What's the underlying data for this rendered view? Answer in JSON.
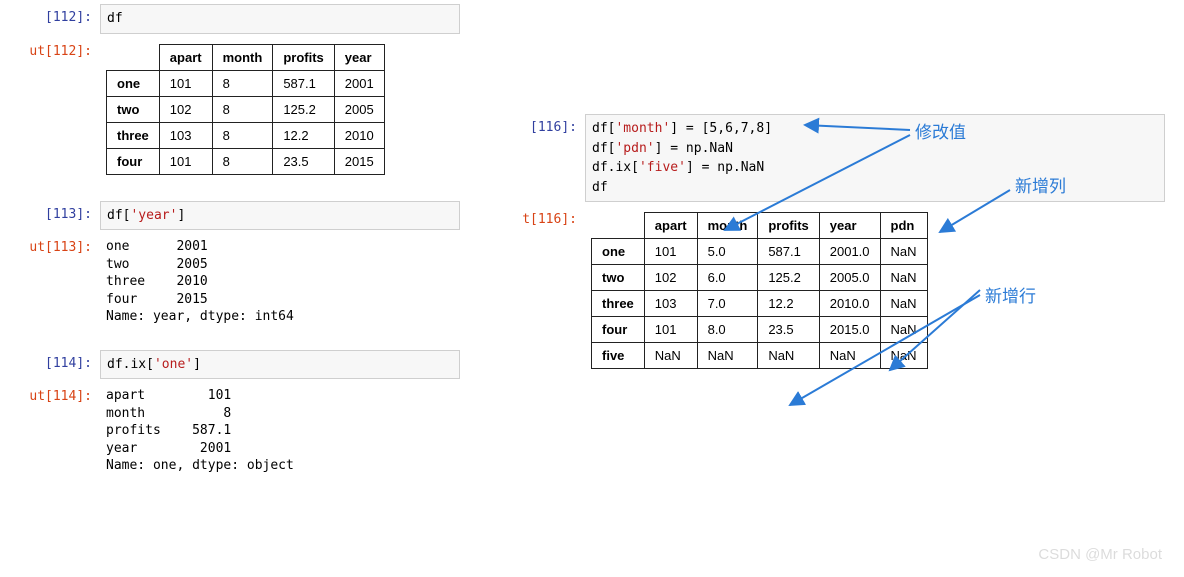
{
  "left": {
    "c112": {
      "in_prompt": "[112]:",
      "out_prompt": "ut[112]:",
      "code": "df",
      "table": {
        "headers": [
          "",
          "apart",
          "month",
          "profits",
          "year"
        ],
        "rows": [
          [
            "one",
            "101",
            "8",
            "587.1",
            "2001"
          ],
          [
            "two",
            "102",
            "8",
            "125.2",
            "2005"
          ],
          [
            "three",
            "103",
            "8",
            "12.2",
            "2010"
          ],
          [
            "four",
            "101",
            "8",
            "23.5",
            "2015"
          ]
        ]
      }
    },
    "c113": {
      "in_prompt": "[113]:",
      "out_prompt": "ut[113]:",
      "code_pre": "df[",
      "code_str": "'year'",
      "code_post": "]",
      "output": "one      2001\ntwo      2005\nthree    2010\nfour     2015\nName: year, dtype: int64"
    },
    "c114": {
      "in_prompt": "[114]:",
      "out_prompt": "ut[114]:",
      "code_pre": "df.ix[",
      "code_str": "'one'",
      "code_post": "]",
      "output": "apart        101\nmonth          8\nprofits    587.1\nyear        2001\nName: one, dtype: object"
    }
  },
  "right": {
    "c116": {
      "in_prompt": "[116]:",
      "out_prompt": "t[116]:",
      "code": {
        "l1a": "df[",
        "l1b": "'month'",
        "l1c": "] = [5,6,7,8]",
        "l2a": "df[",
        "l2b": "'pdn'",
        "l2c": "] = np.NaN",
        "l3a": "df.ix[",
        "l3b": "'five'",
        "l3c": "] = np.NaN",
        "l4": "df"
      },
      "table": {
        "headers": [
          "",
          "apart",
          "month",
          "profits",
          "year",
          "pdn"
        ],
        "rows": [
          [
            "one",
            "101",
            "5.0",
            "587.1",
            "2001.0",
            "NaN"
          ],
          [
            "two",
            "102",
            "6.0",
            "125.2",
            "2005.0",
            "NaN"
          ],
          [
            "three",
            "103",
            "7.0",
            "12.2",
            "2010.0",
            "NaN"
          ],
          [
            "four",
            "101",
            "8.0",
            "23.5",
            "2015.0",
            "NaN"
          ],
          [
            "five",
            "NaN",
            "NaN",
            "NaN",
            "NaN",
            "NaN"
          ]
        ]
      }
    },
    "annotations": {
      "modify_value": "修改值",
      "new_column": "新增列",
      "new_row": "新增行"
    }
  },
  "watermark": "CSDN @Mr Robot"
}
